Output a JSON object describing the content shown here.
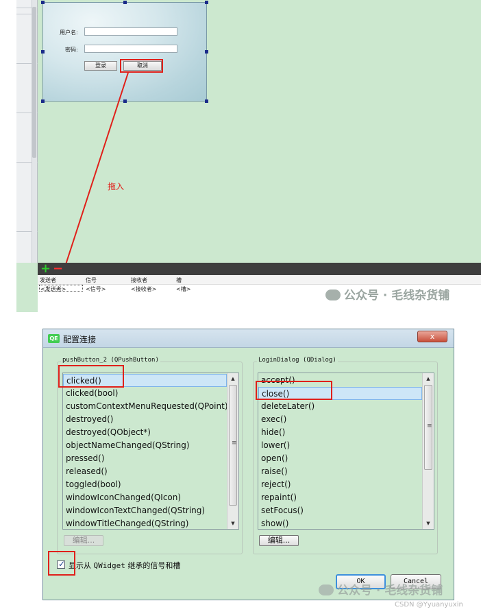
{
  "form": {
    "username_label": "用户名:",
    "password_label": "密码:",
    "login_button": "登录",
    "cancel_button": "取消"
  },
  "annotation": {
    "drag_label": "拖入"
  },
  "connection_table": {
    "headers": [
      "发送者",
      "信号",
      "接收者",
      "槽"
    ],
    "cells": [
      "<发送者>",
      "<信号>",
      "<接收者>",
      "<槽>"
    ]
  },
  "watermark": {
    "text": "公众号 · 毛线杂货铺"
  },
  "dialog": {
    "title": "配置连接",
    "icon_text": "QE",
    "close_symbol": "x",
    "sender_group_title": "pushButton_2 (QPushButton)",
    "receiver_group_title": "LoginDialog (QDialog)",
    "signals": [
      "clicked()",
      "clicked(bool)",
      "customContextMenuRequested(QPoint)",
      "destroyed()",
      "destroyed(QObject*)",
      "objectNameChanged(QString)",
      "pressed()",
      "released()",
      "toggled(bool)",
      "windowIconChanged(QIcon)",
      "windowIconTextChanged(QString)",
      "windowTitleChanged(QString)"
    ],
    "slots": [
      "accept()",
      "close()",
      "deleteLater()",
      "exec()",
      "hide()",
      "lower()",
      "open()",
      "raise()",
      "reject()",
      "repaint()",
      "setFocus()",
      "show()"
    ],
    "selected_signal": "clicked()",
    "selected_slot": "close()",
    "edit_left": "编辑...",
    "edit_right": "编辑...",
    "show_inherited_prefix": "显示从 ",
    "show_inherited_class": "QWidget",
    "show_inherited_suffix": " 继承的信号和槽",
    "show_inherited_checked": true,
    "ok_button": "OK",
    "cancel_button": "Cancel"
  },
  "csdn_credit": "CSDN @Yyuanyuxin",
  "colors": {
    "background_green": "#cce8cf",
    "highlight_red": "#e0201a",
    "selection_blue": "#cde6f7",
    "toolbar_dark": "#3e3e3e"
  }
}
